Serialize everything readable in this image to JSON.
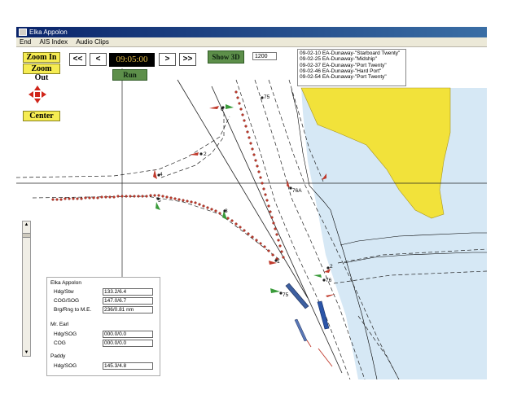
{
  "window": {
    "title": "Elka Appolon"
  },
  "menu": [
    "End",
    "AIS Index",
    "Audio Clips"
  ],
  "zoom": {
    "zoom_in": "Zoom In",
    "zoom_out": "Zoom Out",
    "center": "Center"
  },
  "playback": {
    "rewind": "<<",
    "step_back": "<",
    "time": "09:05:00",
    "step_forward": ">",
    "fast_forward": ">>",
    "run": "Run"
  },
  "view": {
    "show_3d": "Show 3D",
    "scale": "1200"
  },
  "event_log": [
    "09-02-10 EA-Dunaway-\"Starboard Twenty\"",
    "09-02-25 EA-Dunaway-\"Midship\"",
    "09-02-37 EA-Dunaway-\"Port Twenty\"",
    "09-02-46 EA-Dunaway-\"Hard Port\"",
    "09-02-54 EA-Dunaway-\"Port Twenty\""
  ],
  "buoys": [
    "6",
    "2",
    "4",
    "5",
    "3",
    "75",
    "76A",
    "1",
    "75",
    "2",
    "76"
  ],
  "vessels": [
    {
      "name": "Elka Appolon",
      "fields": [
        {
          "label": "Hdg/Stw",
          "value": "133.2/6.4"
        },
        {
          "label": "COG/SOG",
          "value": "147.0/6.7"
        },
        {
          "label": "Brg/Rng to M.E.",
          "value": "236/0.81 nm"
        }
      ]
    },
    {
      "name": "Mr. Earl",
      "fields": [
        {
          "label": "Hdg/SOG",
          "value": "000.0/0.0"
        },
        {
          "label": "COG",
          "value": "000.0/0.0"
        }
      ]
    },
    {
      "name": "Paddy",
      "fields": [
        {
          "label": "Hdg/SOG",
          "value": "145.3/4.8"
        }
      ]
    }
  ],
  "colors": {
    "land": "#f2e23a",
    "water": "#d6e8f5",
    "track": "#c0392b",
    "nav_button": "#5d8f4a",
    "zoom_button": "#f6ec52",
    "clock_text": "#e6bf4a"
  }
}
